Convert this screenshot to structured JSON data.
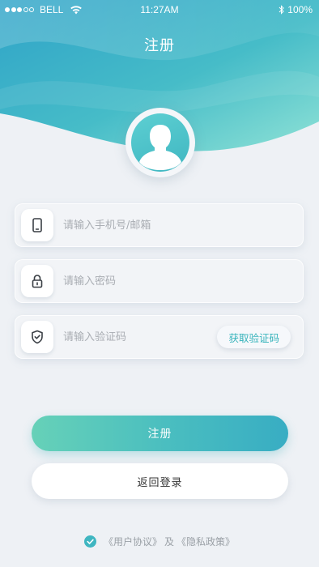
{
  "status_bar": {
    "carrier": "BELL",
    "time": "11:27AM",
    "battery": "100%"
  },
  "header": {
    "title": "注册"
  },
  "form": {
    "account": {
      "placeholder": "请输入手机号/邮箱",
      "value": ""
    },
    "password": {
      "placeholder": "请输入密码",
      "value": ""
    },
    "code": {
      "placeholder": "请输入验证码",
      "value": ""
    },
    "get_code_label": "获取验证码"
  },
  "actions": {
    "register_label": "注册",
    "back_login_label": "返回登录"
  },
  "agreement": {
    "user_agreement": "《用户协议》",
    "and": "及",
    "privacy_policy": "《隐私政策》"
  },
  "colors": {
    "accent": "#3fb6c1",
    "accent_light": "#66d1b8",
    "background": "#eef1f5"
  },
  "icons": {
    "account": "phone-icon",
    "password": "lock-icon",
    "code": "shield-check-icon",
    "avatar": "user-silhouette-icon",
    "agree": "check-circle-icon"
  }
}
